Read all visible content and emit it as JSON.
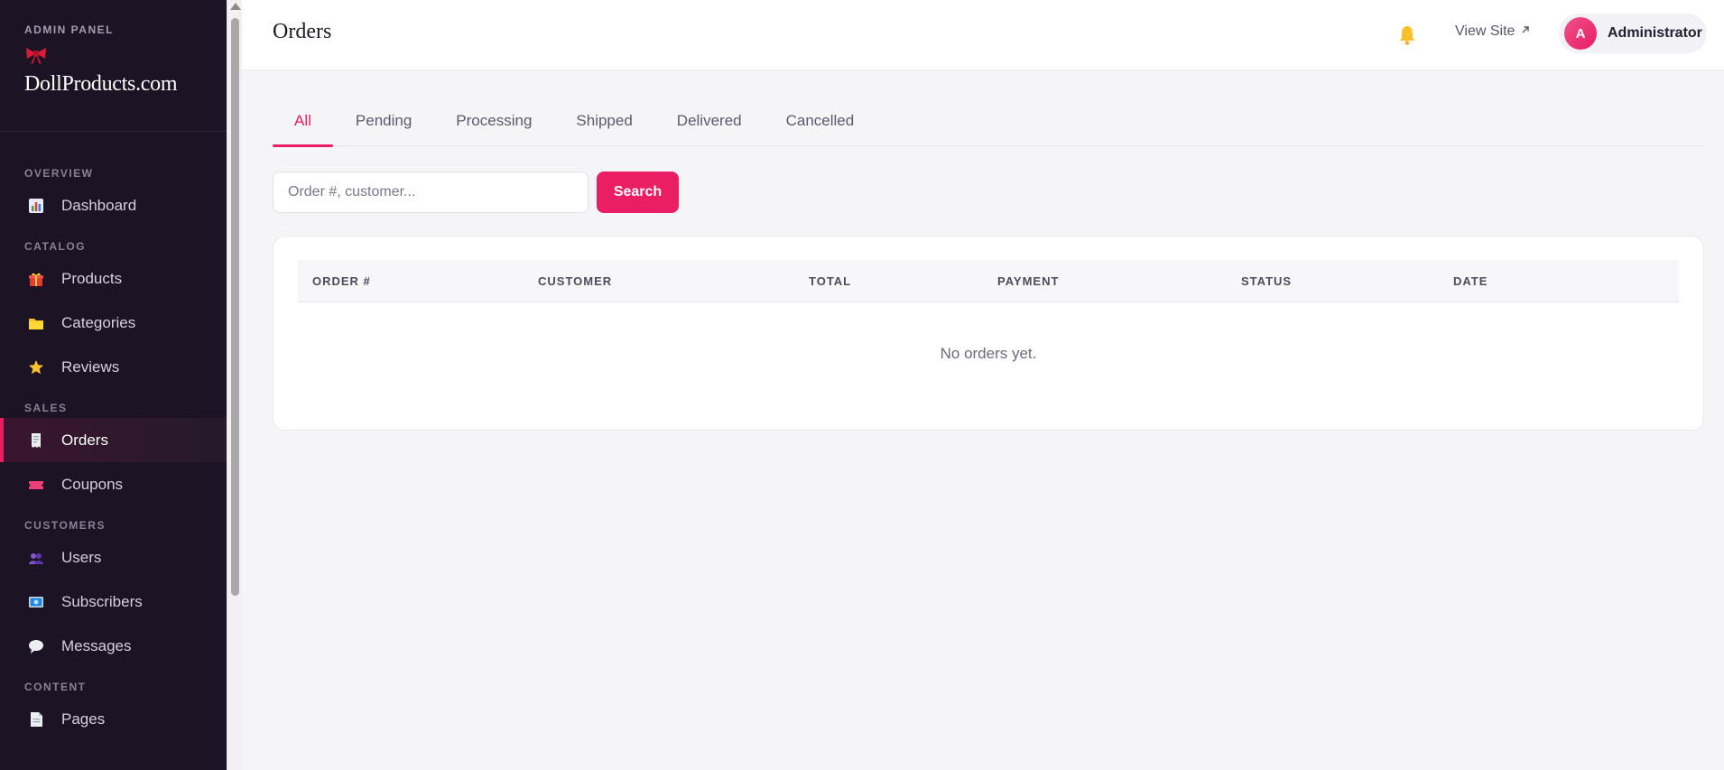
{
  "sidebar": {
    "panel_label": "ADMIN PANEL",
    "brand_name": "DollProducts.com",
    "sections": [
      {
        "title": "OVERVIEW",
        "items": [
          {
            "label": "Dashboard",
            "icon": "chart-icon"
          }
        ]
      },
      {
        "title": "CATALOG",
        "items": [
          {
            "label": "Products",
            "icon": "gift-icon"
          },
          {
            "label": "Categories",
            "icon": "folder-icon"
          },
          {
            "label": "Reviews",
            "icon": "star-icon"
          }
        ]
      },
      {
        "title": "SALES",
        "items": [
          {
            "label": "Orders",
            "icon": "receipt-icon",
            "active": true
          },
          {
            "label": "Coupons",
            "icon": "ticket-icon"
          }
        ]
      },
      {
        "title": "CUSTOMERS",
        "items": [
          {
            "label": "Users",
            "icon": "users-icon"
          },
          {
            "label": "Subscribers",
            "icon": "mail-icon"
          },
          {
            "label": "Messages",
            "icon": "chat-icon"
          }
        ]
      },
      {
        "title": "CONTENT",
        "items": [
          {
            "label": "Pages",
            "icon": "page-icon"
          }
        ]
      }
    ]
  },
  "header": {
    "title": "Orders",
    "view_site": "View Site",
    "user": {
      "initial": "A",
      "name": "Administrator"
    }
  },
  "tabs": [
    "All",
    "Pending",
    "Processing",
    "Shipped",
    "Delivered",
    "Cancelled"
  ],
  "search": {
    "placeholder": "Order #, customer...",
    "button": "Search"
  },
  "table": {
    "columns": [
      "ORDER #",
      "CUSTOMER",
      "TOTAL",
      "PAYMENT",
      "STATUS",
      "DATE"
    ],
    "empty_message": "No orders yet."
  },
  "colors": {
    "accent": "#e91e63",
    "sidebar_bg": "#1c1424"
  }
}
